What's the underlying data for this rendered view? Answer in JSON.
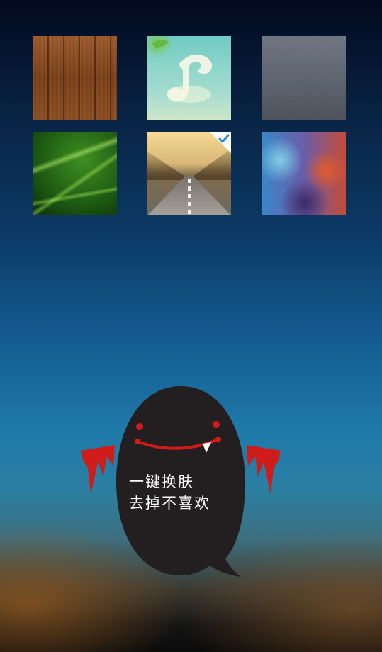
{
  "skins": [
    {
      "name": "wood",
      "selected": false
    },
    {
      "name": "music-logo",
      "selected": false
    },
    {
      "name": "grey-metal",
      "selected": false
    },
    {
      "name": "green-grass",
      "selected": false
    },
    {
      "name": "road",
      "selected": true
    },
    {
      "name": "blurred-color",
      "selected": false
    }
  ],
  "mascot": {
    "line1": "一键换肤",
    "line2": "去掉不喜欢"
  },
  "colors": {
    "check": "#2e86de",
    "mascot_body": "#231f20",
    "mascot_red": "#d01b1b"
  }
}
